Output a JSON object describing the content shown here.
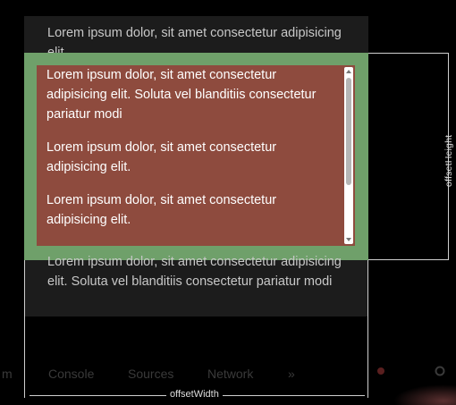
{
  "paragraphs": {
    "top": "Lorem ipsum dolor, sit amet consectetur adipisicing elit.",
    "bottom": "Lorem ipsum dolor, sit amet consectetur adipisicing elit. Soluta vel blanditiis consectetur pariatur modi"
  },
  "scroll_box": {
    "items": [
      "Lorem ipsum dolor, sit amet consectetur adipisicing elit. Soluta vel blanditiis consectetur pariatur modi",
      "Lorem ipsum dolor, sit amet consectetur adipisicing elit.",
      "Lorem ipsum dolor, sit amet consectetur adipisicing elit."
    ]
  },
  "labels": {
    "offset_height": "offsetHeight",
    "offset_width": "offsetWidth"
  },
  "devtools": {
    "tabs": [
      "m",
      "Console",
      "Sources",
      "Network",
      "»"
    ],
    "icons": [
      "error-badge-icon",
      "settings-icon"
    ]
  },
  "colors": {
    "green_box": "#6fa06a",
    "red_box": "#8e4b3e",
    "page_bg": "#1c1c1c"
  }
}
